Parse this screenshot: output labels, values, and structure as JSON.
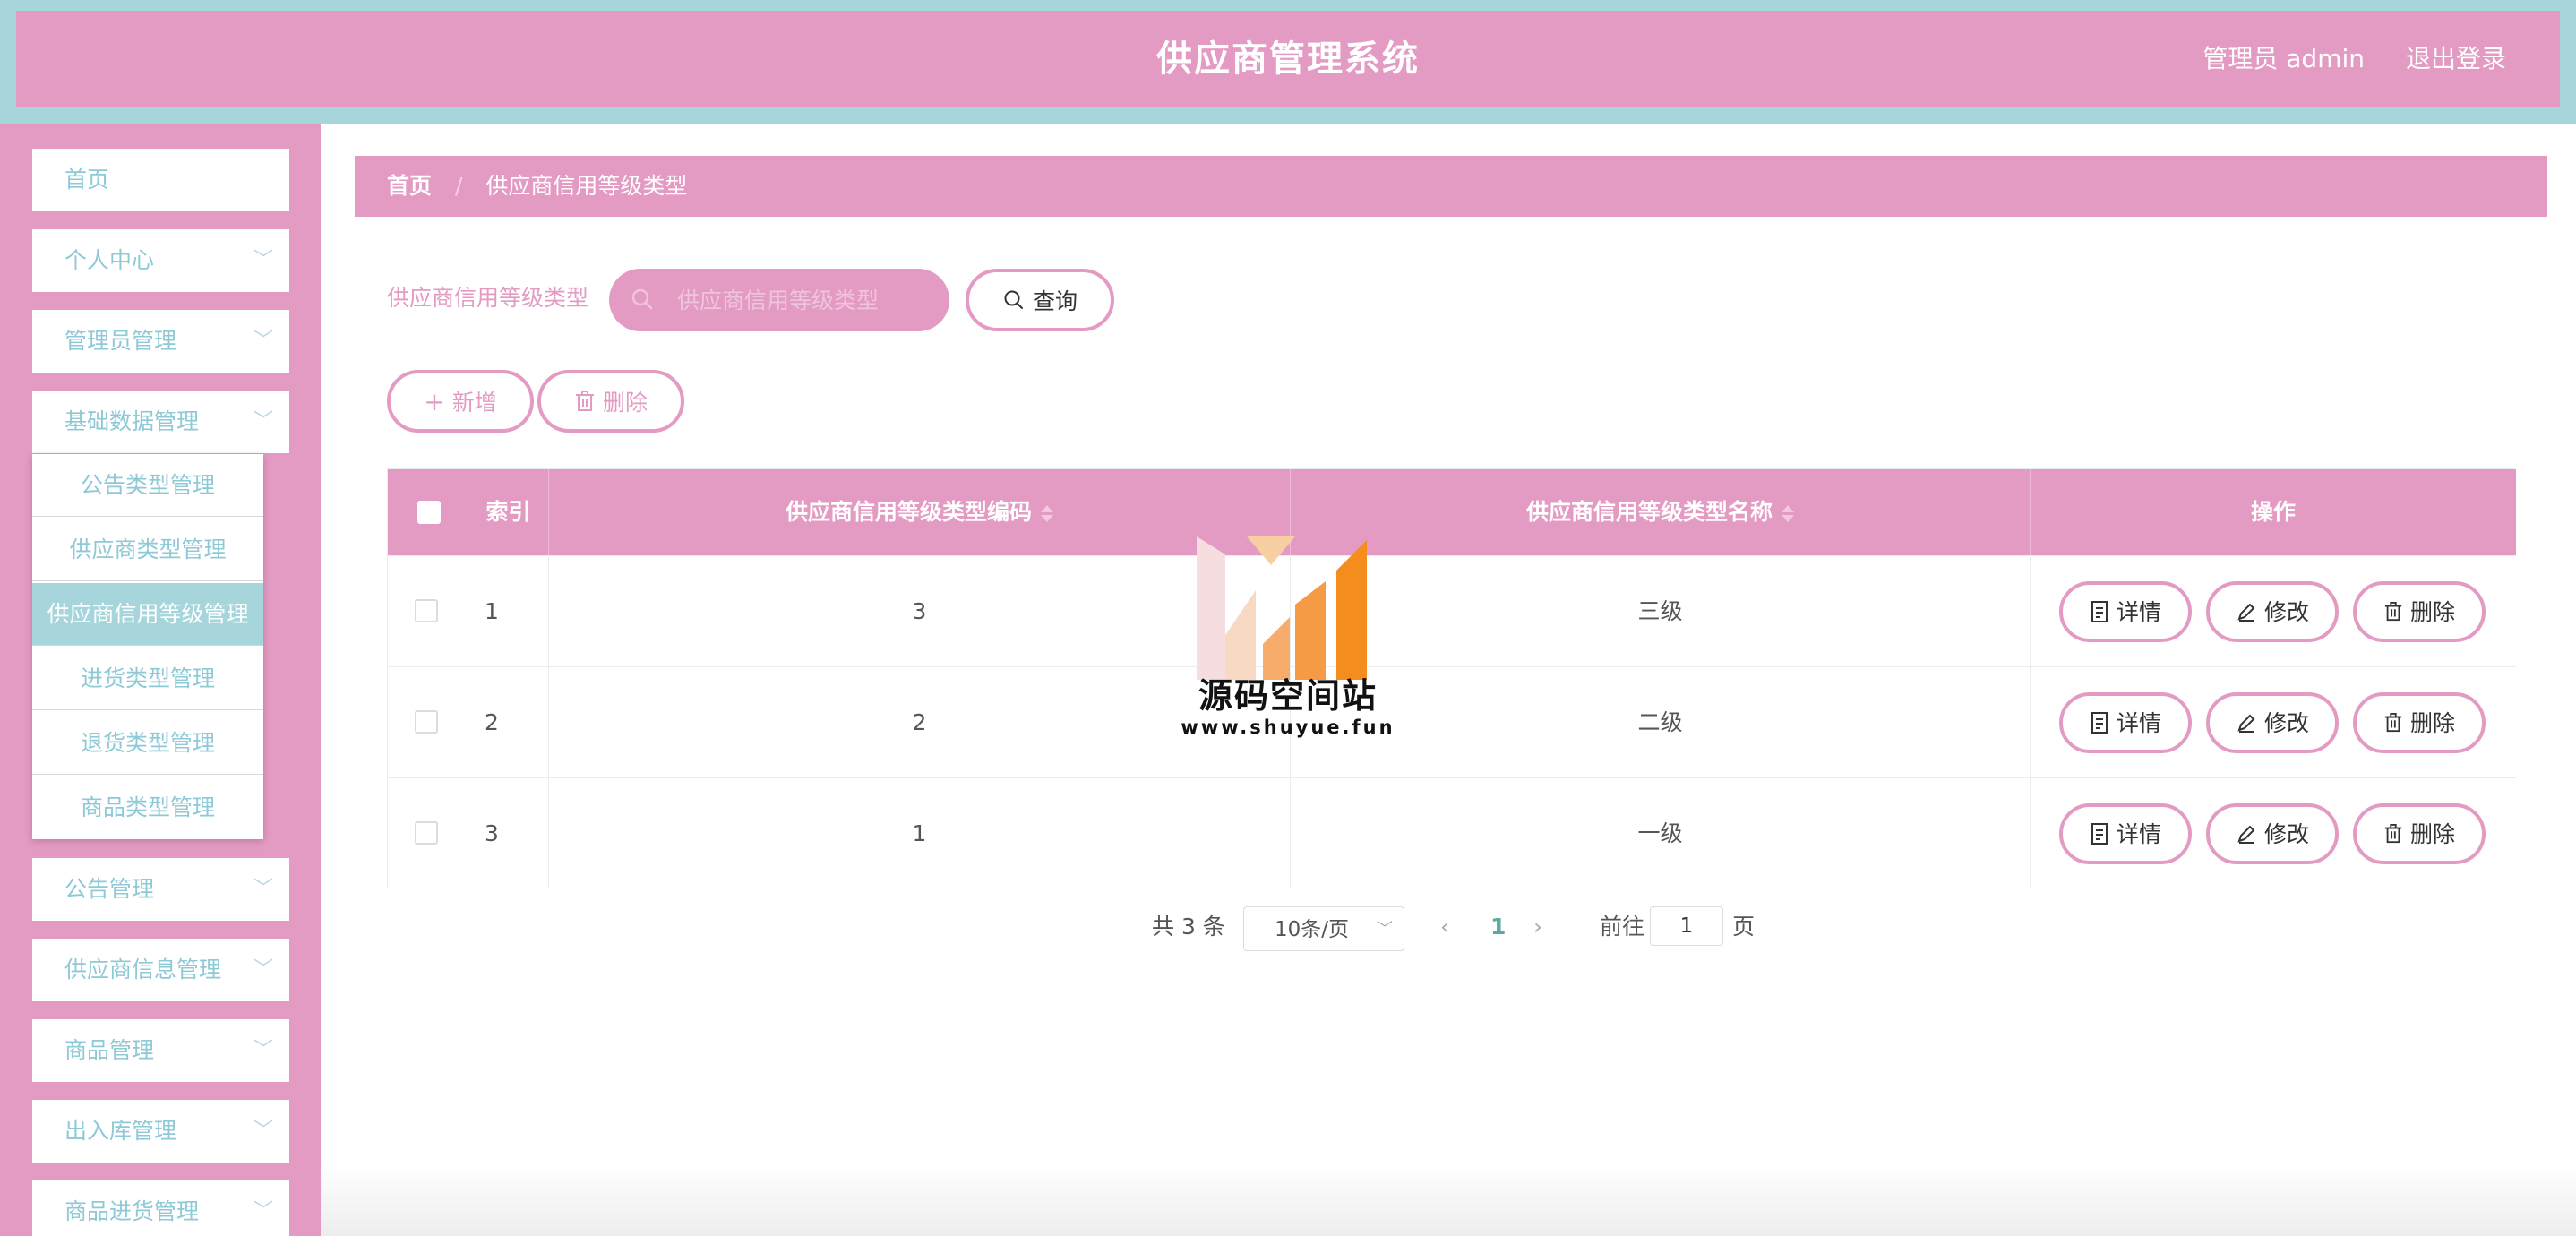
{
  "header": {
    "title": "供应商管理系统",
    "user": "管理员 admin",
    "logout": "退出登录"
  },
  "sidebar": {
    "items": [
      {
        "label": "首页"
      },
      {
        "label": "个人中心"
      },
      {
        "label": "管理员管理"
      },
      {
        "label": "基础数据管理"
      },
      {
        "label": "公告管理"
      },
      {
        "label": "供应商信息管理"
      },
      {
        "label": "商品管理"
      },
      {
        "label": "出入库管理"
      },
      {
        "label": "商品进货管理"
      }
    ],
    "submenu": [
      {
        "label": "公告类型管理"
      },
      {
        "label": "供应商类型管理"
      },
      {
        "label": "供应商信用等级管理"
      },
      {
        "label": "进货类型管理"
      },
      {
        "label": "退货类型管理"
      },
      {
        "label": "商品类型管理"
      }
    ]
  },
  "breadcrumb": {
    "home": "首页",
    "separator": "/",
    "current": "供应商信用等级类型"
  },
  "search": {
    "label": "供应商信用等级类型",
    "placeholder": "供应商信用等级类型",
    "query_button": "查询"
  },
  "actions": {
    "add": "新增",
    "delete": "删除"
  },
  "table": {
    "columns": [
      "索引",
      "供应商信用等级类型编码",
      "供应商信用等级类型名称",
      "操作"
    ],
    "rows": [
      {
        "index": "1",
        "code": "3",
        "name": "三级"
      },
      {
        "index": "2",
        "code": "2",
        "name": "二级"
      },
      {
        "index": "3",
        "code": "1",
        "name": "一级"
      }
    ],
    "row_actions": {
      "detail": "详情",
      "edit": "修改",
      "delete": "删除"
    }
  },
  "pagination": {
    "total": "共 3 条",
    "page_size": "10条/页",
    "current_page": "1",
    "goto_prefix": "前往",
    "goto_value": "1",
    "goto_suffix": "页"
  },
  "watermark": {
    "text": "源码空间站",
    "url": "www.shuyue.fun"
  },
  "colors": {
    "primary_pink": "#e39ac3",
    "accent_teal": "#a6d5dc",
    "menu_text": "#8dc9d6",
    "page_active": "#5ba9a1"
  }
}
